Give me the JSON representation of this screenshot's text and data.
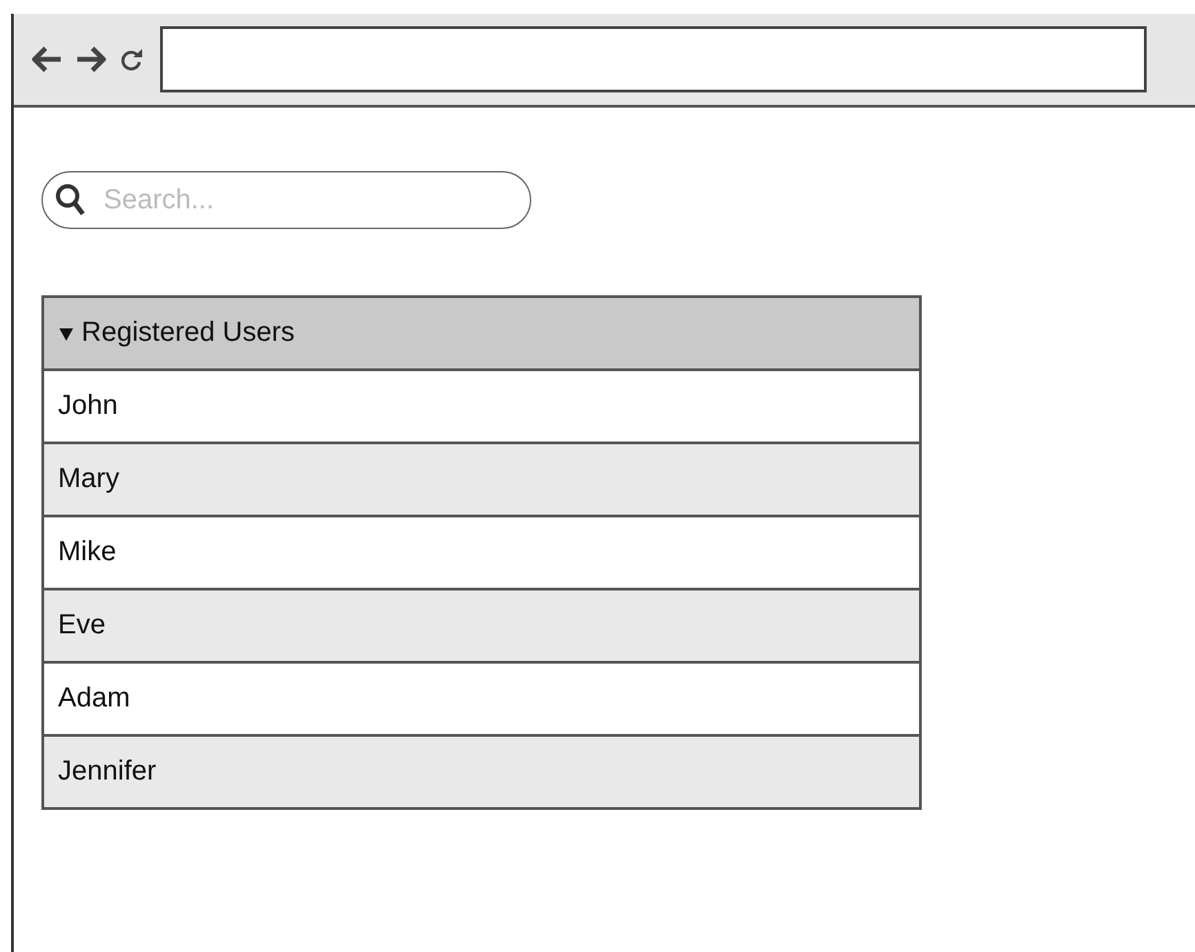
{
  "search": {
    "placeholder": "Search..."
  },
  "list": {
    "title": "Registered Users",
    "expanded": true,
    "items": [
      "John",
      "Mary",
      "Mike",
      "Eve",
      "Adam",
      "Jennifer"
    ]
  }
}
